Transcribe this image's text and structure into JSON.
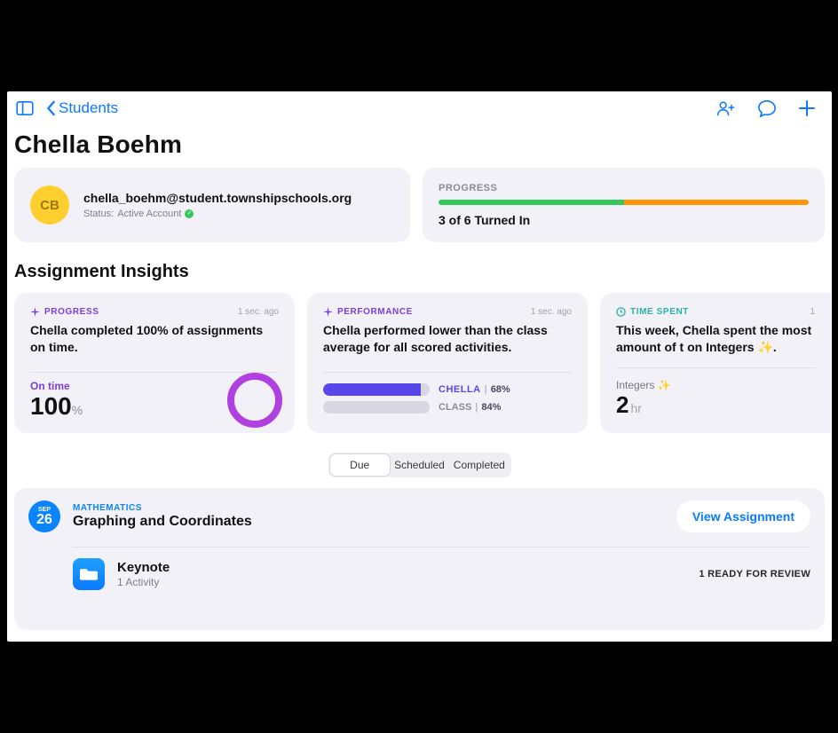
{
  "nav": {
    "back_label": "Students"
  },
  "student": {
    "name": "Chella Boehm",
    "avatar_initials": "CB",
    "email": "chella_boehm@student.townshipschools.org",
    "status_prefix": "Status: ",
    "status_value": "Active Account"
  },
  "progress_summary": {
    "label": "PROGRESS",
    "text": "3 of 6 Turned In",
    "green_pct": 50,
    "orange_pct": 50
  },
  "insights": {
    "section_title": "Assignment Insights",
    "progress": {
      "tag": "PROGRESS",
      "time": "1 sec. ago",
      "body": "Chella completed 100% of assignments on time.",
      "on_time_label": "On time",
      "on_time_value": "100",
      "on_time_unit": "%"
    },
    "performance": {
      "tag": "PERFORMANCE",
      "time": "1 sec. ago",
      "body": "Chella performed lower than the class average for all scored activities.",
      "chella_label": "CHELLA",
      "chella_pct": "68%",
      "chella_fill": 92,
      "class_label": "CLASS",
      "class_pct": "84%"
    },
    "time_spent": {
      "tag": "TIME SPENT",
      "time": "1",
      "body": "This week, Chella spent the most amount of t on Integers ✨.",
      "label": "Integers ✨",
      "value": "2",
      "unit": "hr"
    }
  },
  "tabs": {
    "due": "Due",
    "scheduled": "Scheduled",
    "completed": "Completed"
  },
  "assignment": {
    "month": "SEP",
    "day": "26",
    "subject": "MATHEMATICS",
    "title": "Graphing and Coordinates",
    "view_label": "View Assignment",
    "activity": {
      "title": "Keynote",
      "sub": "1 Activity",
      "status": "1 READY FOR REVIEW"
    }
  }
}
